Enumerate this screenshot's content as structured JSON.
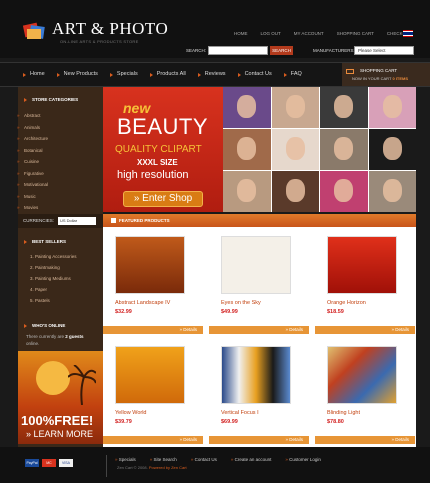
{
  "header": {
    "logo_text": "ART & PHOTO",
    "tagline": "ON-LINE ARTS & PRODUCTS STORE",
    "top_links": [
      "HOME",
      "LOG OUT",
      "MY ACCOUNT",
      "SHOPPING CART",
      "CHECKOUT"
    ],
    "search_label": "SEARCH:",
    "search_button": "SEARCH",
    "manufacturers_label": "MANUFACTURERS:",
    "manufacturers_value": "Please Select"
  },
  "nav": {
    "items": [
      "Home",
      "New Products",
      "Specials",
      "Products All",
      "Reviews",
      "Contact Us",
      "FAQ"
    ]
  },
  "cart": {
    "title": "SHOPPING CART",
    "text": "NOW IN YOUR CART",
    "count": "0 ITEMS"
  },
  "sidebar": {
    "categories_title": "STORE CATEGORIES",
    "categories": [
      "Abstract",
      "Animals",
      "Architecture",
      "Botanical",
      "Cuisine",
      "Figurative",
      "Motivational",
      "Music",
      "Movies"
    ],
    "currencies_label": "CURRENCIES:",
    "currency_value": "US Dollar",
    "bestsellers_title": "BEST SELLERS",
    "bestsellers": [
      "1. Painting Accessories",
      "2. Paintmaking",
      "3. Painting Mediums",
      "4. Paper",
      "5. Pastels"
    ],
    "whos_online_title": "WHO'S ONLINE",
    "whos_online_pre": "There currently are",
    "whos_online_count": "2 guests",
    "whos_online_post": "online.",
    "ad_title": "100%FREE!",
    "ad_link": "» LEARN MORE"
  },
  "banner": {
    "new": "new",
    "beauty": "BEAUTY",
    "quality": "QUALITY CLIPART",
    "size": "XXXL SIZE",
    "resolution": "high resolution",
    "button": "» Enter Shop"
  },
  "featured": {
    "title": "FEATURED PRODUCTS",
    "details_label": "Details",
    "products": [
      {
        "name": "Abstract Landscape IV",
        "price": "$32.99"
      },
      {
        "name": "Eyes on the Sky",
        "price": "$49.99"
      },
      {
        "name": "Orange Horizon",
        "price": "$18.59"
      },
      {
        "name": "Yellow World",
        "price": "$39.79"
      },
      {
        "name": "Vertical Focus I",
        "price": "$69.99"
      },
      {
        "name": "Blinding Light",
        "price": "$78.80"
      }
    ]
  },
  "footer": {
    "payments": [
      "PayPal",
      "MC",
      "VISA"
    ],
    "links": [
      "Specials",
      "Site Search",
      "Contact Us",
      "Create an account",
      "Customer Login"
    ],
    "copyright_pre": "Zen Cart © 2008.",
    "copyright_link": "Powered by Zen Cart"
  }
}
